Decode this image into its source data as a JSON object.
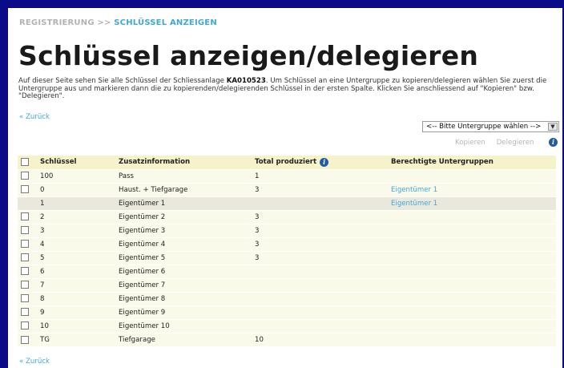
{
  "breadcrumb": {
    "parent": "REGISTRIERUNG",
    "separator": ">>",
    "current": "SCHLÜSSEL ANZEIGEN"
  },
  "page_title": "Schlüssel anzeigen/delegieren",
  "intro": {
    "part1": "Auf dieser Seite sehen Sie alle Schlüssel der Schliessanlage",
    "system_id": "KA010523",
    "part2": ". Um Schlüssel an eine Untergruppe zu kopieren/delegieren wählen Sie zuerst die Untergruppe aus und markieren dann die zu kopierenden/delegierenden Schlüssel in der ersten Spalte. Klicken Sie anschliessend auf \"Kopieren\" bzw. \"Delegieren\"."
  },
  "back_link": "« Zurück",
  "subgroup_select": {
    "selected": "<-- Bitte Untergruppe wählen -->"
  },
  "actions": {
    "copy": "Kopieren",
    "delegate": "Delegieren"
  },
  "table": {
    "headers": {
      "key": "Schlüssel",
      "info": "Zusatzinformation",
      "produced": "Total produziert",
      "groups": "Berechtigte Untergruppen"
    },
    "rows": [
      {
        "key": "100",
        "info": "Pass",
        "produced": "1",
        "groups": ""
      },
      {
        "key": "0",
        "info": "Haust. + Tiefgarage",
        "produced": "3",
        "groups": "Eigentümer 1"
      },
      {
        "key": "1",
        "info": "Eigentümer 1",
        "produced": "",
        "groups": "Eigentümer 1"
      },
      {
        "key": "2",
        "info": "Eigentümer 2",
        "produced": "3",
        "groups": ""
      },
      {
        "key": "3",
        "info": "Eigentümer 3",
        "produced": "3",
        "groups": ""
      },
      {
        "key": "4",
        "info": "Eigentümer 4",
        "produced": "3",
        "groups": ""
      },
      {
        "key": "5",
        "info": "Eigentümer 5",
        "produced": "3",
        "groups": ""
      },
      {
        "key": "6",
        "info": "Eigentümer 6",
        "produced": "",
        "groups": ""
      },
      {
        "key": "7",
        "info": "Eigentümer 7",
        "produced": "",
        "groups": ""
      },
      {
        "key": "8",
        "info": "Eigentümer 8",
        "produced": "",
        "groups": ""
      },
      {
        "key": "9",
        "info": "Eigentümer 9",
        "produced": "",
        "groups": ""
      },
      {
        "key": "10",
        "info": "Eigentümer 10",
        "produced": "",
        "groups": ""
      },
      {
        "key": "TG",
        "info": "Tiefgarage",
        "produced": "10",
        "groups": ""
      }
    ]
  }
}
